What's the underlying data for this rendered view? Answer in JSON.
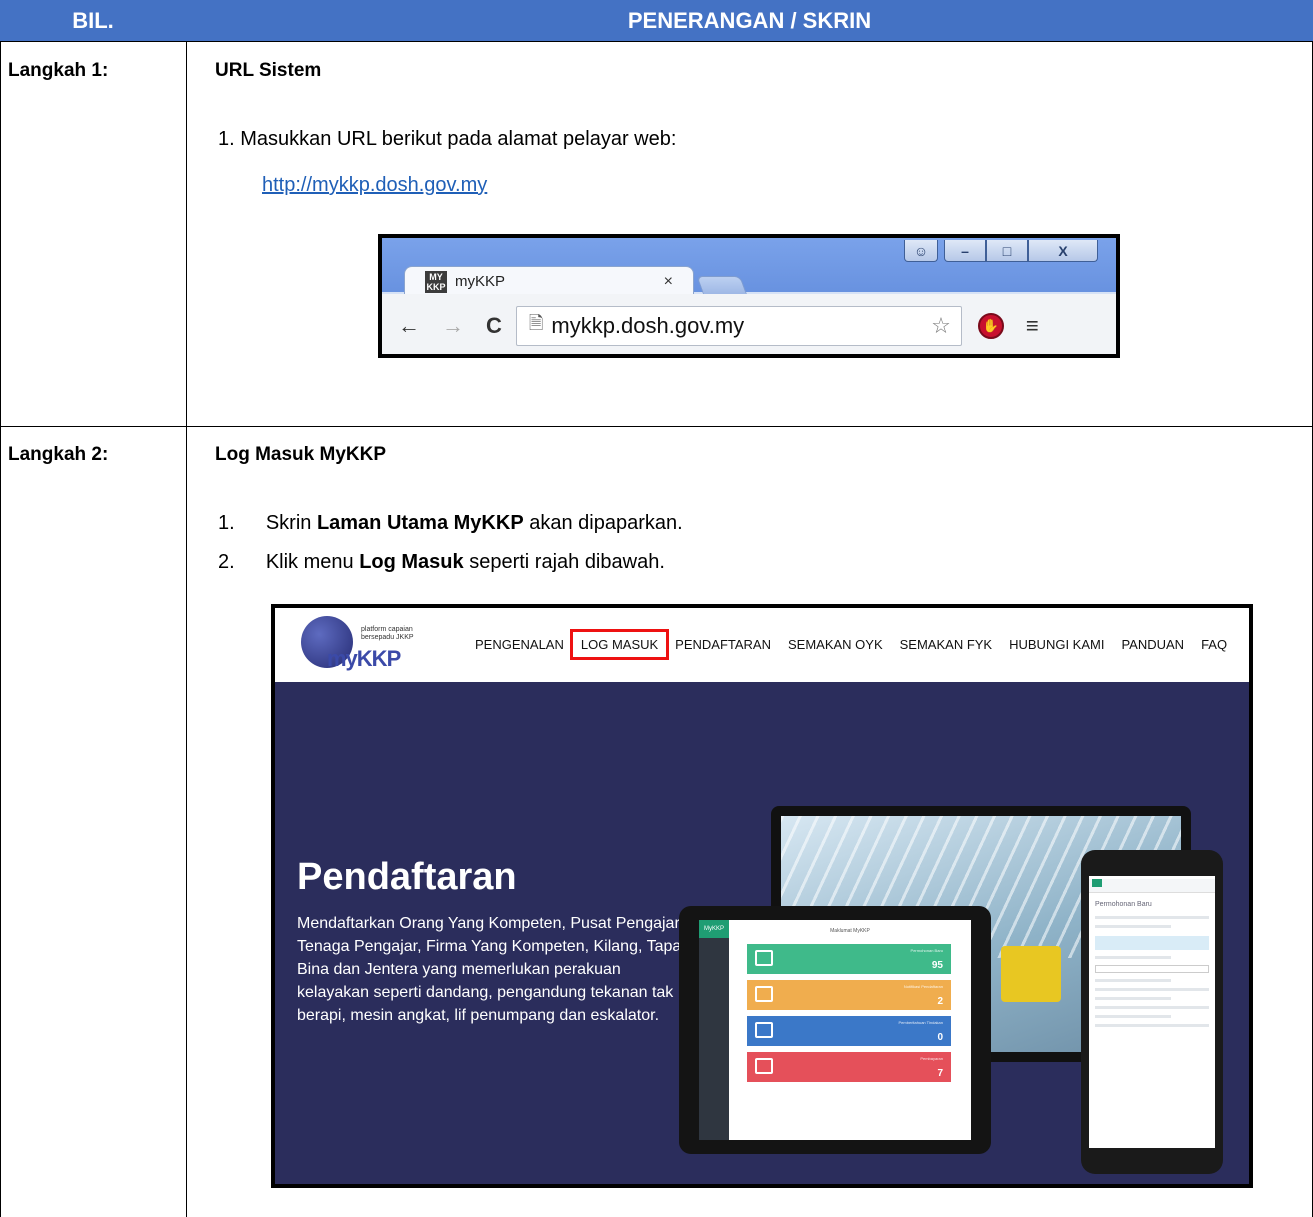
{
  "table": {
    "header_left": "BIL.",
    "header_right": "PENERANGAN / SKRIN"
  },
  "step1": {
    "label": "Langkah 1:",
    "title": "URL Sistem",
    "item1_num": "1.",
    "item1_text": "Masukkan URL berikut pada alamat pelayar web:",
    "link": "http://mykkp.dosh.gov.my"
  },
  "browser": {
    "tab_title": "myKKP",
    "favicon_text": "MY KKP",
    "tab_close": "×",
    "address": "mykkp.dosh.gov.my",
    "btn_user": "☺",
    "btn_min": "–",
    "btn_max": "□",
    "btn_close": "X",
    "back": "←",
    "forward": "→",
    "reload": "C",
    "star": "☆",
    "menu": "≡"
  },
  "step2": {
    "label": "Langkah 2:",
    "title": "Log Masuk MyKKP",
    "item1_num": "1.",
    "item1_pre": "Skrin ",
    "item1_bold": "Laman Utama MyKKP",
    "item1_post": " akan dipaparkan.",
    "item2_num": "2.",
    "item2_pre": "Klik menu ",
    "item2_bold": "Log Masuk",
    "item2_post": " seperti rajah dibawah."
  },
  "site": {
    "logo_tag_1": "platform capaian",
    "logo_tag_2": "bersepadu JKKP",
    "logo_wordmark": "myKKP",
    "menu": [
      "PENGENALAN",
      "LOG MASUK",
      "PENDAFTARAN",
      "SEMAKAN OYK",
      "SEMAKAN FYK",
      "HUBUNGI KAMI",
      "PANDUAN",
      "FAQ"
    ],
    "hero_title": "Pendaftaran",
    "hero_text": "Mendaftarkan Orang Yang Kompeten, Pusat Pengajar, Tenaga Pengajar, Firma Yang Kompeten, Kilang, Tapak Bina dan Jentera yang memerlukan perakuan kelayakan seperti dandang, pengandung tekanan tak berapi, mesin angkat, lif penumpang dan eskalator.",
    "tablet_brand": "MyKKP",
    "tablet_title": "Maklumat MyKKP",
    "cards": [
      {
        "label": "Permohonan Baru",
        "value": "95",
        "color": "#3fba8a"
      },
      {
        "label": "Notifikasi Pendaftaran",
        "value": "2",
        "color": "#f0ad4e"
      },
      {
        "label": "Pemberitahuan Tindakan",
        "value": "0",
        "color": "#3b78c8"
      },
      {
        "label": "Pembayaran",
        "value": "7",
        "color": "#e5505a"
      }
    ],
    "phone_header": "Permohonan Baru"
  },
  "colors": {
    "header_bg": "#4472C4",
    "link": "#1f5fb7",
    "highlight": "#e11",
    "hero_bg": "#2b2d5c"
  }
}
